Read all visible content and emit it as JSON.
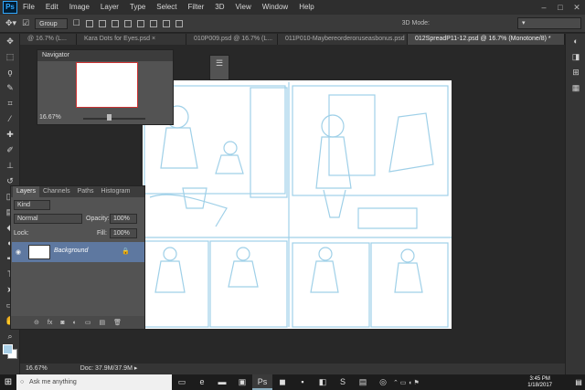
{
  "app": {
    "logo": "Ps"
  },
  "menu": [
    "File",
    "Edit",
    "Image",
    "Layer",
    "Type",
    "Select",
    "Filter",
    "3D",
    "View",
    "Window",
    "Help"
  ],
  "window_controls": [
    "–",
    "□",
    "✕"
  ],
  "options_bar": {
    "auto_select_value": "Group",
    "mode_3d_label": "3D Mode:"
  },
  "tabs": [
    {
      "label": "@ 16.7% (L...",
      "active": false
    },
    {
      "label": "Kara Dots for Eyes.psd",
      "active": false
    },
    {
      "label": "010P009.psd @ 16.7% (L...",
      "active": false
    },
    {
      "label": "011P010-Maybereorderoruseasbonus.psd",
      "active": false
    },
    {
      "label": "012SpreadP11-12.psd @ 16.7% (Monotone/8) *",
      "active": true
    }
  ],
  "tab_close": "×",
  "navigator": {
    "title": "Navigator",
    "zoom": "16.67%"
  },
  "layers_panel": {
    "tabs": [
      "Layers",
      "Channels",
      "Paths",
      "Histogram"
    ],
    "kind_label": "Kind",
    "blend_mode": "Normal",
    "opacity_label": "Opacity:",
    "opacity_value": "100%",
    "lock_label": "Lock:",
    "fill_label": "Fill:",
    "fill_value": "100%",
    "layer": {
      "name": "Background"
    },
    "footer_icons": [
      "⊝",
      "fx",
      "◙",
      "◐",
      "▭",
      "▤",
      "🗑"
    ]
  },
  "status": {
    "zoom": "16.67%",
    "doc": "Doc: 37.9M/37.9M"
  },
  "taskbar": {
    "search_placeholder": "Ask me anything",
    "time": "3:45 PM",
    "date": "1/18/2017"
  },
  "colors": {
    "foreground": "#a9cfe7",
    "background": "#ffffff",
    "sketch": "#9fd0e8"
  }
}
